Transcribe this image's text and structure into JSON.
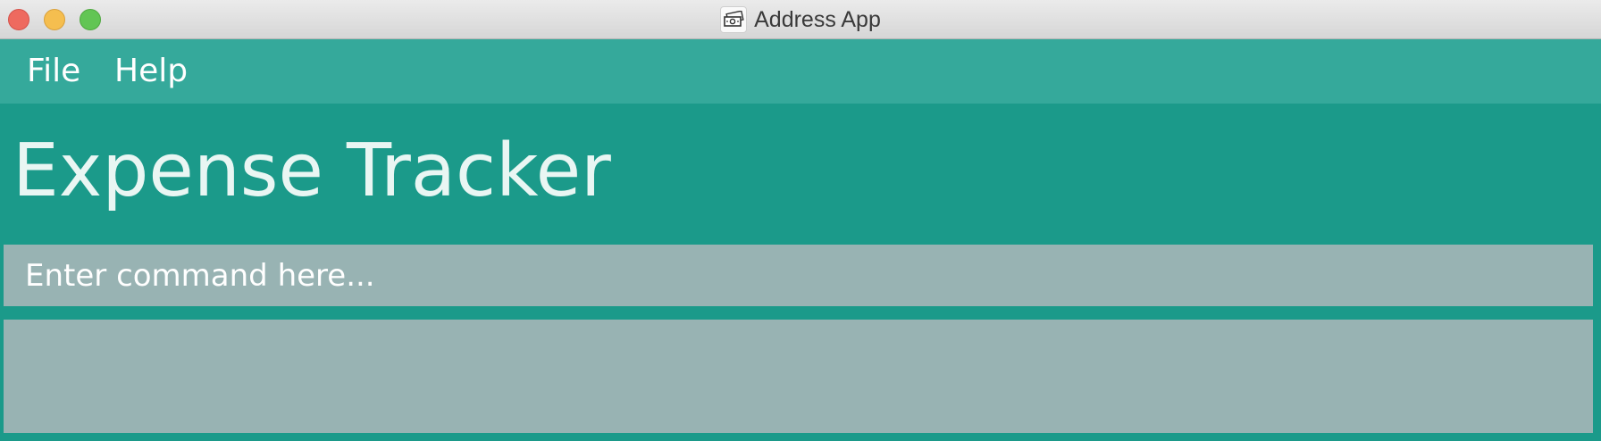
{
  "window": {
    "title": "Address App",
    "app_icon": "money-bill-icon"
  },
  "menu": {
    "items": [
      {
        "label": "File"
      },
      {
        "label": "Help"
      }
    ]
  },
  "main": {
    "heading": "Expense Tracker",
    "command_input": {
      "value": "",
      "placeholder": "Enter command here..."
    },
    "result_display": {
      "text": ""
    }
  },
  "colors": {
    "background": "#1b9a8a",
    "menubar": "#35a99b",
    "input_background": "#98b3b3",
    "heading_text": "#e9f6f3"
  }
}
